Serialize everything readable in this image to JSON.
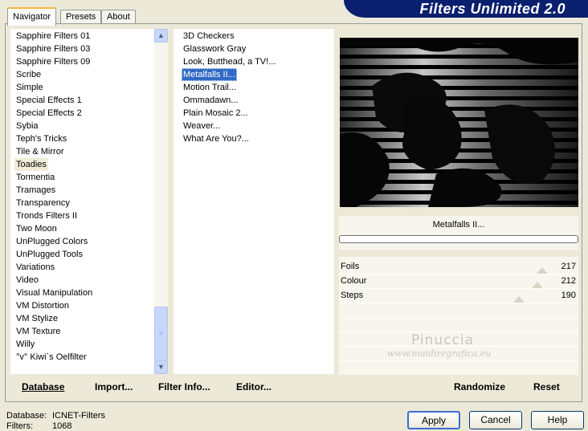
{
  "app": {
    "banner_title": "Filters Unlimited 2.0"
  },
  "tabs": [
    {
      "label": "Navigator",
      "active": true
    },
    {
      "label": "Presets",
      "active": false
    },
    {
      "label": "About",
      "active": false
    }
  ],
  "categories": {
    "items": [
      "Sapphire Filters 01",
      "Sapphire Filters 03",
      "Sapphire Filters 09",
      "Scribe",
      "Simple",
      "Special Effects 1",
      "Special Effects 2",
      "Sybia",
      "Teph's Tricks",
      "Tile & Mirror",
      "Toadies",
      "Tormentia",
      "Tramages",
      "Transparency",
      "Tronds Filters II",
      "Two Moon",
      "UnPlugged Colors",
      "UnPlugged Tools",
      "Variations",
      "Video",
      "Visual Manipulation",
      "VM Distortion",
      "VM Stylize",
      "VM Texture",
      "Willy",
      "°v° Kiwi`s Oelfilter"
    ],
    "highlighted": "Toadies"
  },
  "filters": {
    "items": [
      "3D Checkers",
      "Glasswork Gray",
      "Look, Butthead, a TV!...",
      "Metalfalls II...",
      "Motion Trail...",
      "Ommadawn...",
      "Plain Mosaic 2...",
      "Weaver...",
      "What Are You?..."
    ],
    "selected": "Metalfalls II..."
  },
  "left_buttons": {
    "database": "Database",
    "import": "Import...",
    "filter_info": "Filter Info...",
    "editor": "Editor..."
  },
  "preview": {
    "filter_name": "Metalfalls II..."
  },
  "params": [
    {
      "label": "Foils",
      "value": "217",
      "fraction": 0.85
    },
    {
      "label": "Colour",
      "value": "212",
      "fraction": 0.83
    },
    {
      "label": "Steps",
      "value": "190",
      "fraction": 0.75
    }
  ],
  "watermark": {
    "name": "Pinuccia",
    "site": "www.maidiregrafica.eu"
  },
  "right_buttons": {
    "randomize": "Randomize",
    "reset": "Reset"
  },
  "status": {
    "database_label": "Database:",
    "database_value": "ICNET-Filters",
    "filters_label": "Filters:",
    "filters_value": "1068"
  },
  "dialog_buttons": {
    "apply": "Apply",
    "cancel": "Cancel",
    "help": "Help"
  }
}
